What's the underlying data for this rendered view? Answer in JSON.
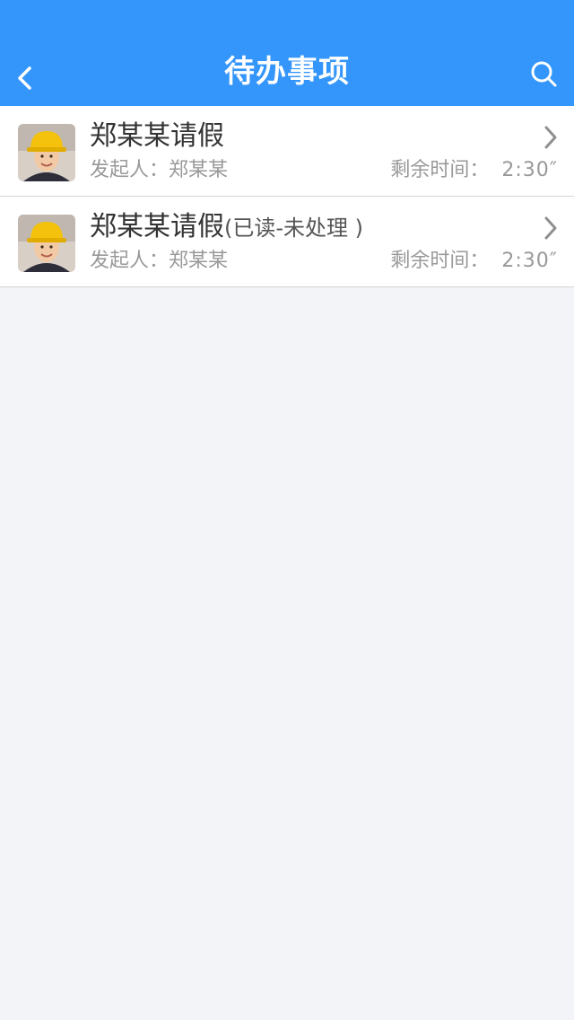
{
  "header": {
    "title": "待办事项",
    "back_icon": "chevron-left-icon",
    "search_icon": "search-icon",
    "background": "#3496fb"
  },
  "items": [
    {
      "name": "郑某某请假",
      "status": "",
      "initiator": "发起人：郑某某",
      "remaining_label": "剩余时间：",
      "remaining_value": "2:30″",
      "avatar": "avatar-worker-yellow-helmet"
    },
    {
      "name": "郑某某请假",
      "status": "(已读-未处理 )",
      "initiator": "发起人：郑某某",
      "remaining_label": "剩余时间：",
      "remaining_value": "2:30″",
      "avatar": "avatar-worker-yellow-helmet"
    }
  ]
}
